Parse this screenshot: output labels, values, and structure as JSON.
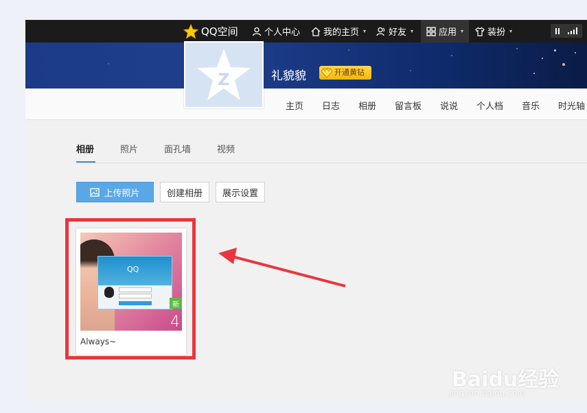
{
  "topbar": {
    "brand": "QQ空间",
    "items": [
      {
        "label": "个人中心"
      },
      {
        "label": "我的主页"
      },
      {
        "label": "好友"
      },
      {
        "label": "应用"
      },
      {
        "label": "装扮"
      }
    ]
  },
  "profile": {
    "name": "礼貌貌",
    "vip_label": "开通黄钻"
  },
  "nav": {
    "items": [
      "主页",
      "日志",
      "相册",
      "留言板",
      "说说",
      "个人档",
      "音乐",
      "时光轴"
    ]
  },
  "subtabs": {
    "items": [
      "相册",
      "照片",
      "面孔墙",
      "视频"
    ]
  },
  "actions": {
    "upload": "上传照片",
    "create": "创建相册",
    "display": "展示设置"
  },
  "album": {
    "title": "Always~",
    "badge": "新",
    "count": "4",
    "thumb_text": "QQ"
  },
  "watermark": {
    "main": "Baidu经验",
    "sub": "jingyan.baidu.com"
  },
  "colors": {
    "topbar": "#1b1b1b",
    "banner": "#1f3f8e",
    "accent": "#5aa7e6",
    "highlight": "#e9363c",
    "vip": "#f5b50f"
  }
}
